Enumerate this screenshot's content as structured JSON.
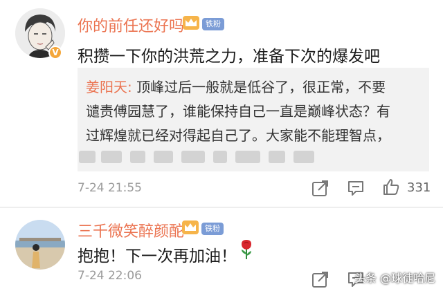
{
  "comments": [
    {
      "username": "你的前任还好吗",
      "fan_badge": "铁粉",
      "verified": "V",
      "text": "积攒一下你的洪荒之力，准备下次的爆发吧",
      "quote": {
        "user": "姜阳天:",
        "line1": "顶峰过后一般就是低谷了，很正常，不要",
        "line2": "谴责傅园慧了，谁能保持自己一直是巅峰状态？有",
        "line3": "过辉煌就已经对得起自己了。大家能不能理智点，"
      },
      "time": "7-24 21:55",
      "likes": "331"
    },
    {
      "username": "三千微笑醉颜酡",
      "fan_badge": "铁粉",
      "text": "抱抱！下一次再加油！",
      "time": "7-24 22:06"
    }
  ],
  "watermark": "头条 @球徒哈尼",
  "colors": {
    "username": "#eb7350",
    "fan_badge": "#7b9cd6",
    "time": "#9a9a9a",
    "quote_bg": "#f2f2f2"
  },
  "icons": [
    "crown-icon",
    "share-icon",
    "comment-icon",
    "thumbs-up-icon",
    "rose-icon"
  ]
}
